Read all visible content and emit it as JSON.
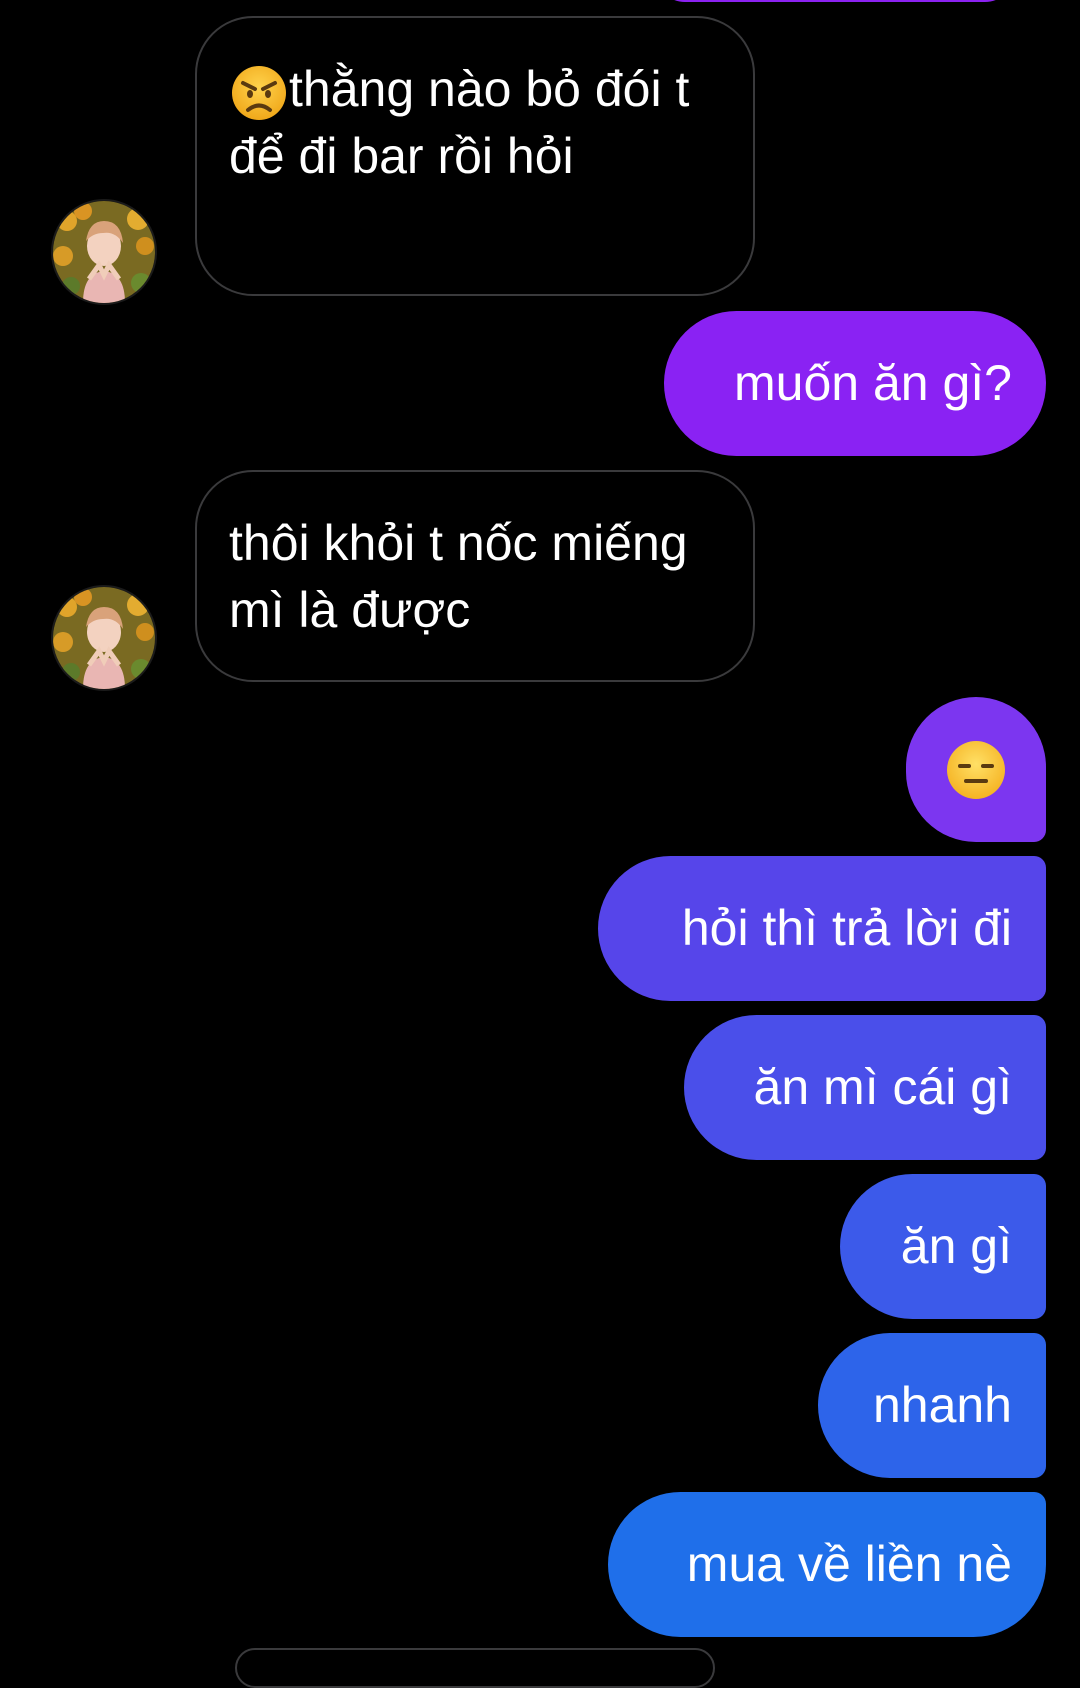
{
  "colors": {
    "background": "#000000",
    "incoming_border": "#3a3a3c",
    "outgoing_top": "#8a2be2",
    "outgoing_bottom": "#1c6fe8"
  },
  "messages": [
    {
      "side": "incoming",
      "emoji": "angry-face-icon",
      "text": "thằng nào bỏ đói t để đi bar rồi hỏi"
    },
    {
      "side": "outgoing",
      "text": "muốn ăn gì?"
    },
    {
      "side": "incoming",
      "text": "thôi khỏi t nốc miếng mì là được"
    },
    {
      "side": "outgoing",
      "emoji": "expressionless-face-icon",
      "text": ""
    },
    {
      "side": "outgoing",
      "text": "hỏi thì trả lời đi"
    },
    {
      "side": "outgoing",
      "text": "ăn mì cái gì"
    },
    {
      "side": "outgoing",
      "text": "ăn gì"
    },
    {
      "side": "outgoing",
      "text": "nhanh"
    },
    {
      "side": "outgoing",
      "text": "mua về liền nè"
    }
  ]
}
